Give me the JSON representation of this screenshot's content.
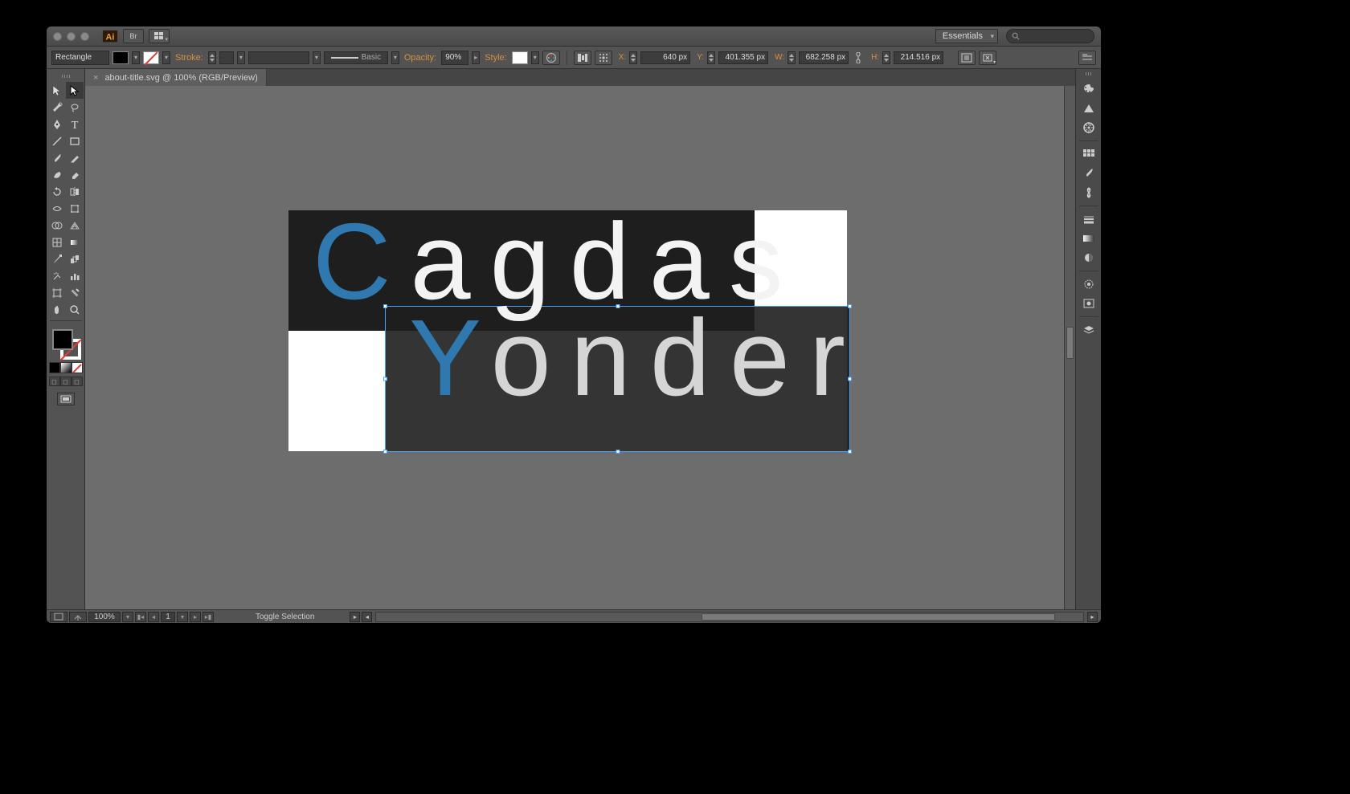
{
  "workspace": "Essentials",
  "control": {
    "shape": "Rectangle",
    "stroke_label": "Stroke:",
    "brush_label": "Basic",
    "opacity_label": "Opacity:",
    "opacity": "90%",
    "style_label": "Style:",
    "x_label": "X:",
    "x": "640 px",
    "y_label": "Y:",
    "y": "401.355 px",
    "w_label": "W:",
    "w": "682.258 px",
    "h_label": "H:",
    "h": "214.516 px"
  },
  "document": {
    "tab": "about-title.svg @ 100% (RGB/Preview)",
    "art_line1_initial": "C",
    "art_line1_rest": "agdas",
    "art_line2_initial": "Y",
    "art_line2_rest": "onder"
  },
  "status": {
    "zoom": "100%",
    "page": "1",
    "msg": "Toggle Selection"
  }
}
